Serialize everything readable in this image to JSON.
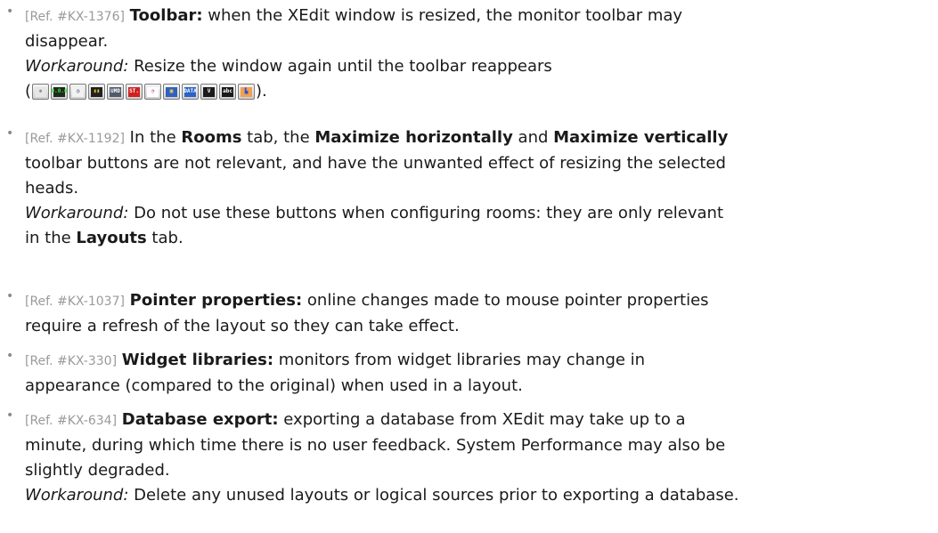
{
  "items": [
    {
      "ref": "[Ref. #KX-1376]",
      "l1_b": "Toolbar:",
      "l1_t": " when the XEdit window is resized, the monitor toolbar may",
      "l2": "disappear.",
      "wa_label": "Workaround:",
      "wa_text": " Resize the window again until the toolbar reappears",
      "paren_open": "(",
      "paren_close": ")."
    },
    {
      "ref": "[Ref. #KX-1192]",
      "l1_a": " In the ",
      "l1_b1": "Rooms",
      "l1_c": " tab, the ",
      "l1_b2": "Maximize horizontally",
      "l1_d": " and ",
      "l1_b3": "Maximize vertically",
      "l2": "toolbar buttons are not relevant, and have the unwanted effect of resizing the selected",
      "l3": "heads.",
      "wa_label": "Workaround:",
      "wa_text": " Do not use these buttons when configuring rooms: they are only relevant",
      "l5_a": "in the ",
      "l5_b": "Layouts",
      "l5_c": " tab."
    },
    {
      "ref": "[Ref. #KX-1037]",
      "l1_b": "Pointer properties:",
      "l1_t": " online changes made to mouse pointer properties",
      "l2": "require a refresh of the layout so they can take effect."
    },
    {
      "ref": "[Ref. #KX-330]",
      "l1_b": "Widget libraries:",
      "l1_t": " monitors from widget libraries may change in",
      "l2": "appearance (compared to the original) when used in a layout."
    },
    {
      "ref": "[Ref. #KX-634]",
      "l1_b": "Database export:",
      "l1_t": " exporting a database from XEdit may take up to a",
      "l2": "minute, during which time there is no user feedback. System Performance may also be",
      "l3": "slightly degraded.",
      "wa_label": "Workaround:",
      "wa_text": " Delete any unused layouts or logical sources prior to exporting a database."
    }
  ],
  "toolbar_icons": [
    {
      "name": "gear-cluster-icon",
      "label": "✲",
      "bg": "#e6e6e6",
      "fg": "#333333"
    },
    {
      "name": "vu-meter-icon",
      "label": "0.0.0",
      "bg": "#1c2b1c",
      "fg": "#38e038"
    },
    {
      "name": "clock-icon",
      "label": "◷",
      "bg": "#f2f2f2",
      "fg": "#2a3d6a"
    },
    {
      "name": "audio-bars-icon",
      "label": "▮▮",
      "bg": "#202020",
      "fg": "#f0c020"
    },
    {
      "name": "umd-icon",
      "label": "UMD",
      "bg": "#505a6a",
      "fg": "#ffffff"
    },
    {
      "name": "status-icon",
      "label": "ST.",
      "bg": "#d02020",
      "fg": "#ffffff"
    },
    {
      "name": "analog-clock-icon",
      "label": "◔",
      "bg": "#ffffff",
      "fg": "#d040a0"
    },
    {
      "name": "video-monitor-icon",
      "label": "▣",
      "bg": "#3060c0",
      "fg": "#ffe040"
    },
    {
      "name": "data-icon",
      "label": "DATA",
      "bg": "#2a62c8",
      "fg": "#ffffff"
    },
    {
      "name": "vchip-icon",
      "label": "V",
      "bg": "#1a1a1a",
      "fg": "#ffffff"
    },
    {
      "name": "text-abc-icon",
      "label": "abc",
      "bg": "#1a1a1a",
      "fg": "#ffffff"
    },
    {
      "name": "image-icon",
      "label": "▙",
      "bg": "#f0a050",
      "fg": "#3050d0"
    }
  ]
}
